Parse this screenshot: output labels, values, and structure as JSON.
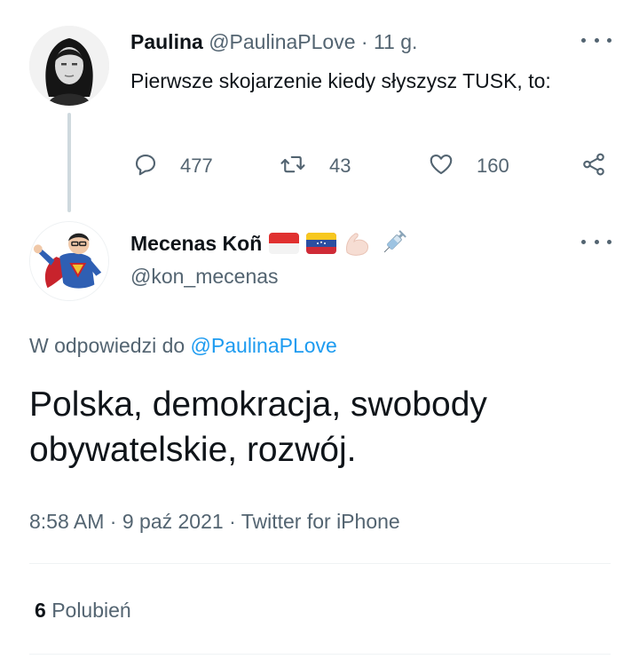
{
  "parent_tweet": {
    "author_name": "Paulina",
    "author_handle": "@PaulinaPLove",
    "separator": "·",
    "time_ago": "11 g.",
    "text": "Pierwsze skojarzenie kiedy słyszysz TUSK, to:",
    "replies": "477",
    "retweets": "43",
    "likes": "160"
  },
  "main_tweet": {
    "author_name": "Mecenas Koñ",
    "author_emojis": [
      "flag-indonesia",
      "flag-venezuela",
      "flexed-biceps-emoji",
      "syringe-emoji"
    ],
    "author_handle": "@kon_mecenas",
    "reply_prefix": "W odpowiedzi do",
    "reply_to_handle": "@PaulinaPLove",
    "text": "Polska, demokracja, swobody obywatelskie, rozwój.",
    "time": "8:58 AM",
    "date": "9 paź 2021",
    "source": "Twitter for iPhone",
    "sep": "·",
    "likes_count": "6",
    "likes_label": "Polubień"
  },
  "icons": {
    "reply": "reply-icon",
    "retweet": "retweet-icon",
    "like": "heart-icon",
    "share": "share-icon",
    "more": "more-icon"
  },
  "colors": {
    "text": "#0f1419",
    "muted": "#536471",
    "link": "#1d9bf0",
    "thread_line": "#cfd9de"
  }
}
